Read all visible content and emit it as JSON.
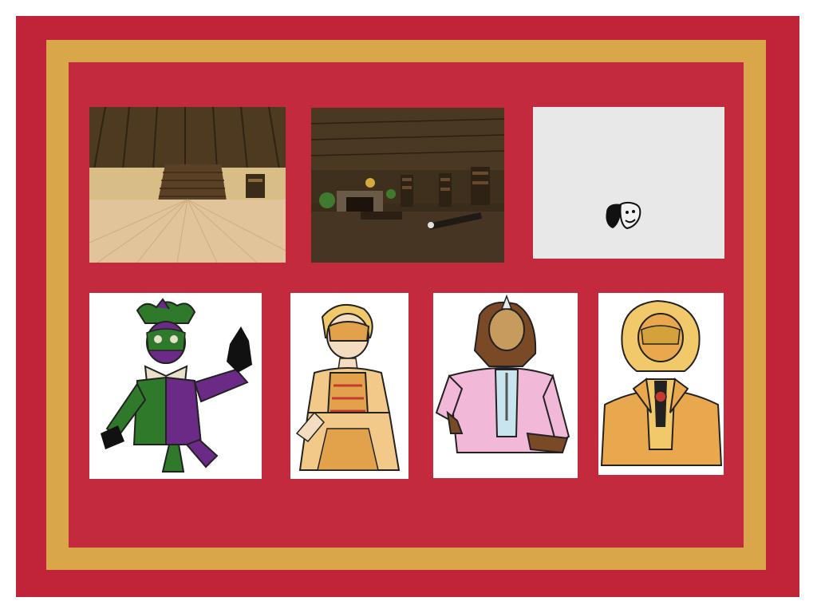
{
  "board": {
    "background_color": "#bf2438",
    "frame_color": "#d9a64a",
    "screenshots": [
      {
        "name": "empty-wooden-hall-screenshot",
        "icon": "3d-room-render"
      },
      {
        "name": "dim-library-room-screenshot",
        "icon": "3d-room-render"
      },
      {
        "name": "theatre-masks-logo-screenshot",
        "icon": "comedy-tragedy-masks-icon"
      }
    ],
    "character_sketches": [
      {
        "name": "jester-character-sketch",
        "colors": [
          "#2f7a2a",
          "#6a2a86",
          "#e8e0c8"
        ]
      },
      {
        "name": "masked-lady-character-sketch",
        "colors": [
          "#e2a24c",
          "#f3c98a",
          "#c43a2e"
        ]
      },
      {
        "name": "unicorn-gentleman-character-sketch",
        "colors": [
          "#f2b8d8",
          "#7a4a26",
          "#c8e4ef"
        ]
      },
      {
        "name": "lion-gentleman-character-sketch",
        "colors": [
          "#e9a84e",
          "#f2c96a",
          "#222222"
        ]
      }
    ]
  }
}
